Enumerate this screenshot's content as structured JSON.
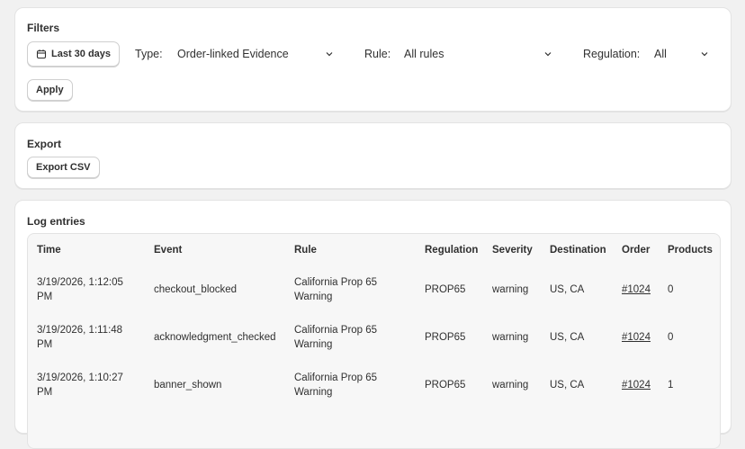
{
  "filters": {
    "title": "Filters",
    "date_button": "Last 30 days",
    "type_label": "Type:",
    "type_value": "Order-linked Evidence",
    "rule_label": "Rule:",
    "rule_value": "All rules",
    "regulation_label": "Regulation:",
    "regulation_value": "All",
    "apply_button": "Apply"
  },
  "export": {
    "title": "Export",
    "csv_button": "Export CSV"
  },
  "log": {
    "title": "Log entries",
    "columns": [
      "Time",
      "Event",
      "Rule",
      "Regulation",
      "Severity",
      "Destination",
      "Order",
      "Products"
    ],
    "rows": [
      {
        "time": "3/19/2026, 1:12:05 PM",
        "event": "checkout_blocked",
        "rule": "California Prop 65 Warning",
        "regulation": "PROP65",
        "severity": "warning",
        "destination": "US, CA",
        "order": "#1024",
        "products": "0"
      },
      {
        "time": "3/19/2026, 1:11:48 PM",
        "event": "acknowledgment_checked",
        "rule": "California Prop 65 Warning",
        "regulation": "PROP65",
        "severity": "warning",
        "destination": "US, CA",
        "order": "#1024",
        "products": "0"
      },
      {
        "time": "3/19/2026, 1:10:27 PM",
        "event": "banner_shown",
        "rule": "California Prop 65 Warning",
        "regulation": "PROP65",
        "severity": "warning",
        "destination": "US, CA",
        "order": "#1024",
        "products": "1"
      }
    ]
  },
  "icons": {
    "calendar": "calendar-icon",
    "chevron": "chevron-down-icon"
  }
}
